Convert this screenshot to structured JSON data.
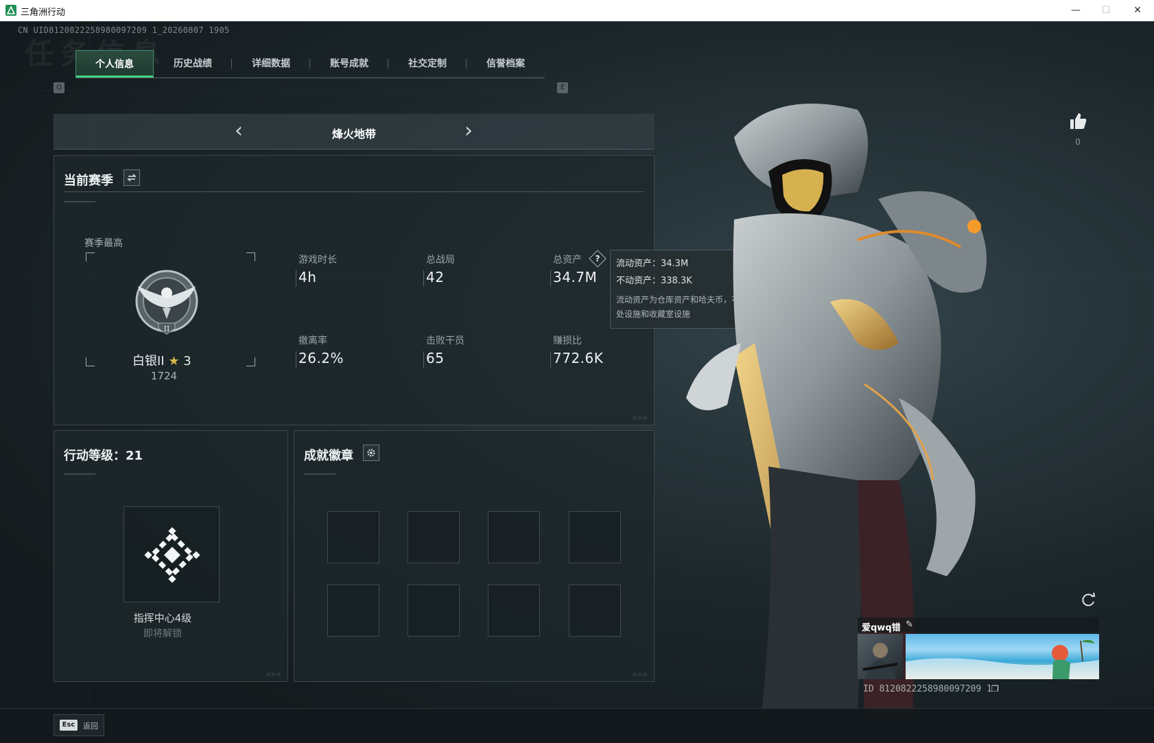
{
  "window": {
    "title": "三角洲行动",
    "minimize": "—",
    "maximize": "☐",
    "close": "✕"
  },
  "uid_line": "CN UID8120822258980097209 1_20260807 1905",
  "bg_title": "任务信息",
  "tabs": {
    "left_key": "Q",
    "right_key": "E",
    "items": [
      {
        "label": "个人信息",
        "active": true
      },
      {
        "label": "历史战绩",
        "active": false
      },
      {
        "label": "详细数据",
        "active": false
      },
      {
        "label": "账号成就",
        "active": false
      },
      {
        "label": "社交定制",
        "active": false
      },
      {
        "label": "信誉档案",
        "active": false
      }
    ]
  },
  "mode": {
    "name": "烽火地带",
    "prev": "‹",
    "next": "›"
  },
  "season": {
    "title": "当前赛季",
    "best_label": "赛季最高",
    "rank_name": "白银II",
    "rank_stars": "3",
    "rank_numeral": "II",
    "rank_score": "1724",
    "stats": [
      {
        "label": "游戏时长",
        "value": "4h"
      },
      {
        "label": "总战局",
        "value": "42"
      },
      {
        "label": "总资产",
        "value": "34.7M"
      },
      {
        "label": "撤离率",
        "value": "26.2%"
      },
      {
        "label": "击败干员",
        "value": "65"
      },
      {
        "label": "赚损比",
        "value": "772.6K"
      }
    ]
  },
  "tooltip": {
    "liquid": "流动资产：34.3M",
    "fixed": "不动资产：338.3K",
    "desc": "流动资产为仓库资产和哈夫币，不动资产为特勤处设施和收藏室设施"
  },
  "level": {
    "title": "行动等级：21",
    "name": "指挥中心4级",
    "lock": "即将解锁"
  },
  "badges": {
    "title": "成就徽章"
  },
  "likes": {
    "count": "0"
  },
  "profile": {
    "name": "爱qwq错",
    "id": "ID 8120822258980097209 1"
  },
  "footer": {
    "esc_key": "Esc",
    "esc_label": "返回"
  },
  "colors": {
    "accent": "#3fd07e",
    "panel": "#1e282c",
    "background": "#1a2326"
  }
}
